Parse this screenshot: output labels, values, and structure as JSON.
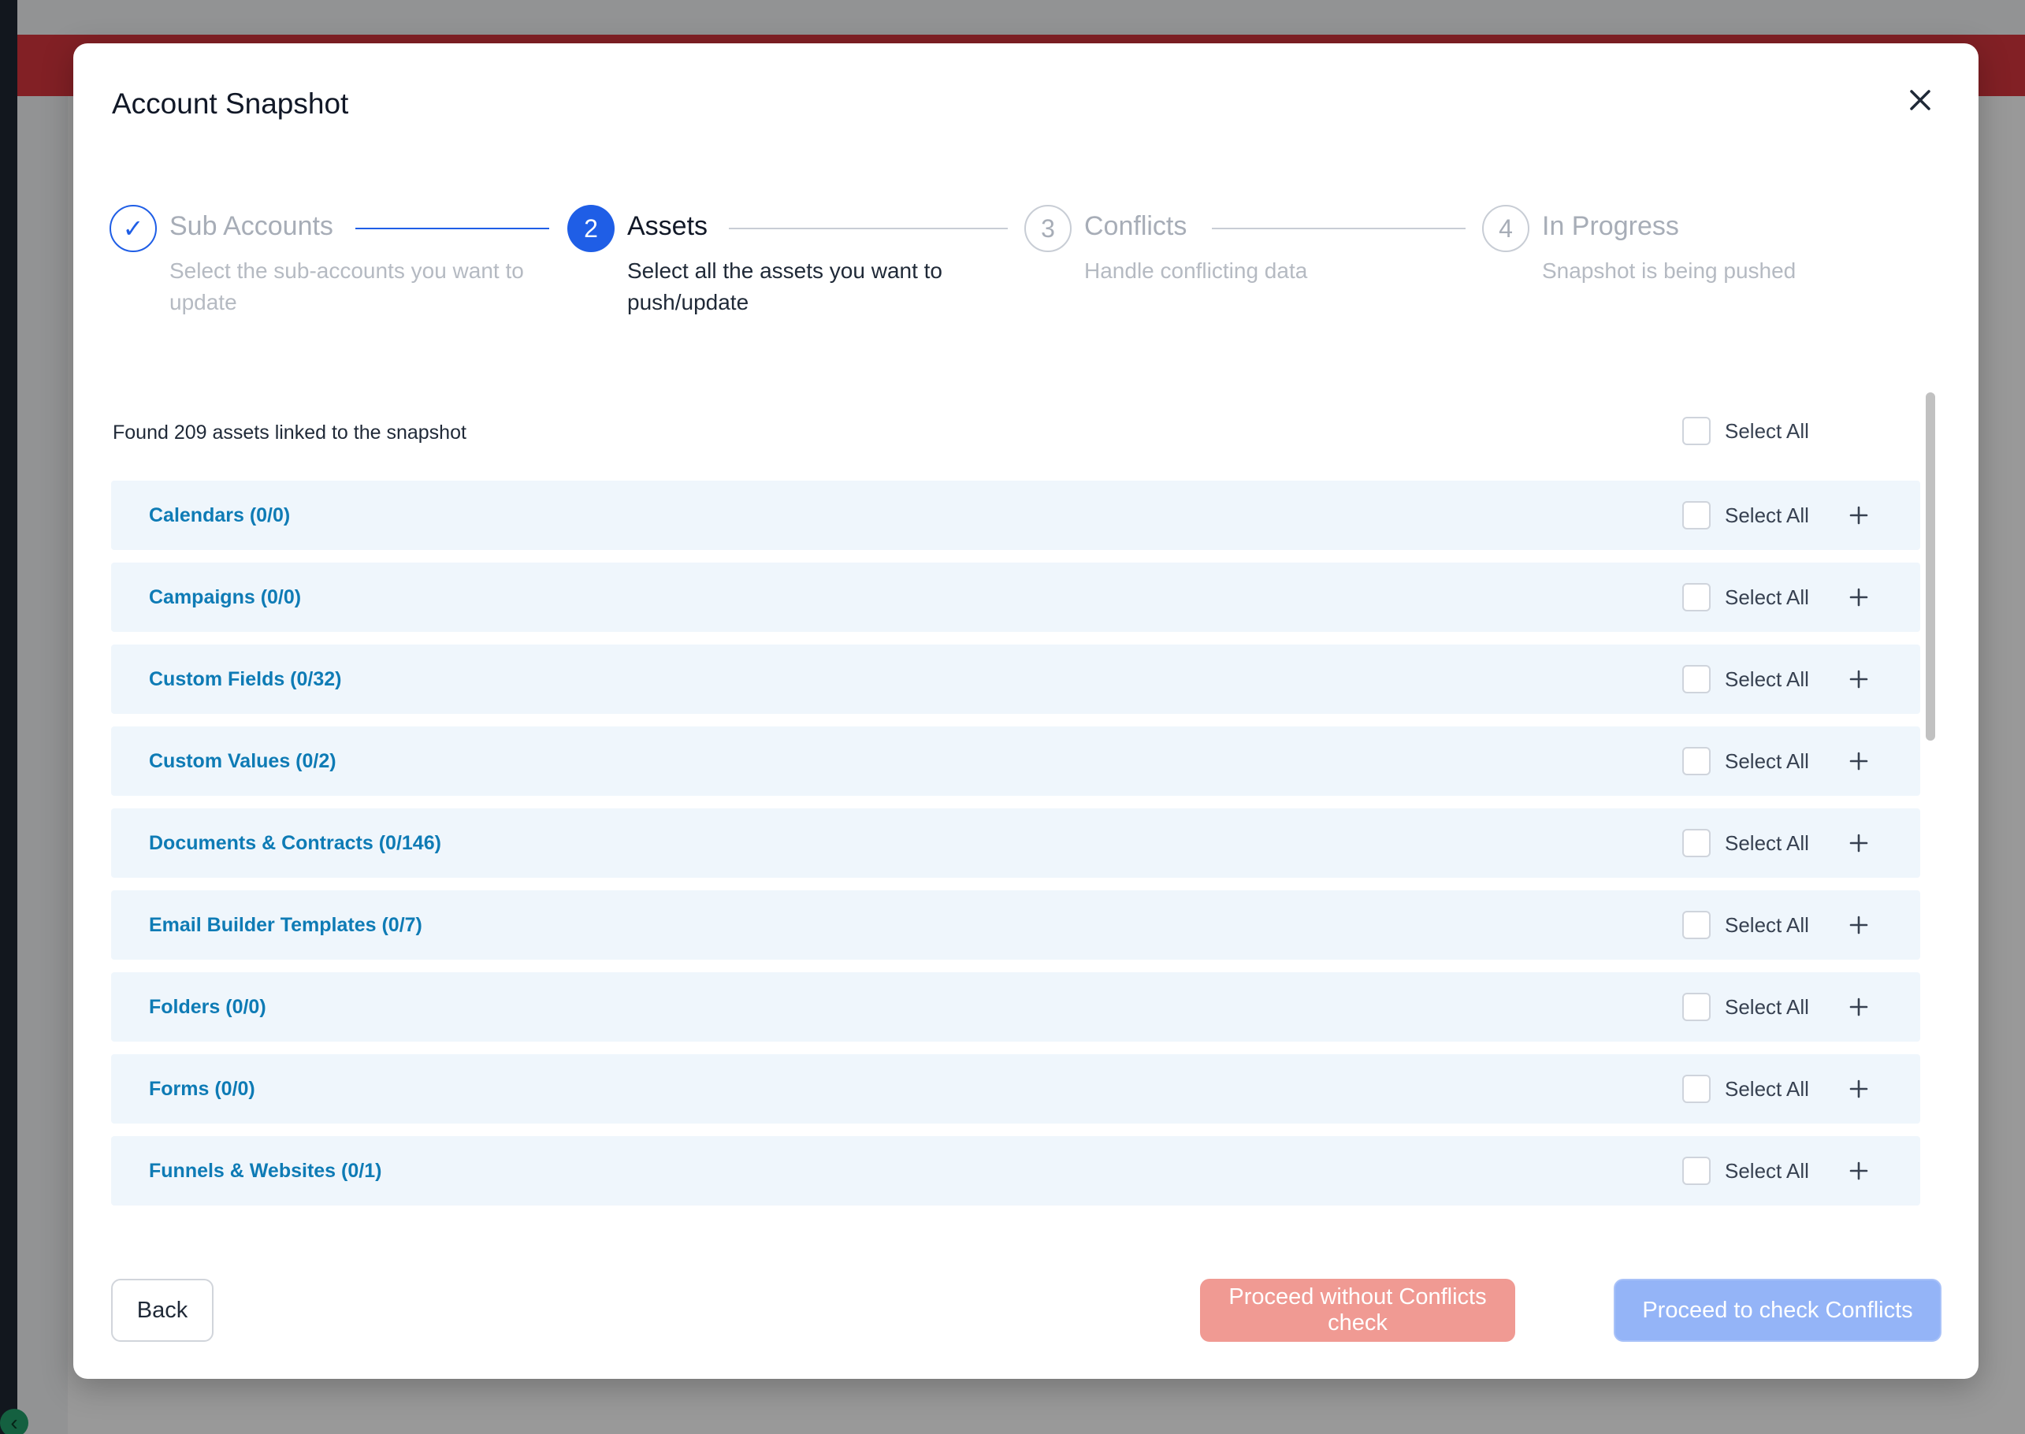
{
  "modal": {
    "title": "Account Snapshot"
  },
  "steps": [
    {
      "number": "✓",
      "title": "Sub Accounts",
      "desc": "Select the sub-accounts you want to update",
      "state": "done"
    },
    {
      "number": "2",
      "title": "Assets",
      "desc": "Select all the assets you want to push/update",
      "state": "active"
    },
    {
      "number": "3",
      "title": "Conflicts",
      "desc": "Handle conflicting data",
      "state": "pending"
    },
    {
      "number": "4",
      "title": "In Progress",
      "desc": "Snapshot is being pushed",
      "state": "pending"
    }
  ],
  "assets": {
    "found_text": "Found 209 assets linked to the snapshot",
    "select_all_label": "Select All",
    "items": [
      {
        "label": "Calendars (0/0)"
      },
      {
        "label": "Campaigns (0/0)"
      },
      {
        "label": "Custom Fields (0/32)"
      },
      {
        "label": "Custom Values (0/2)"
      },
      {
        "label": "Documents & Contracts (0/146)"
      },
      {
        "label": "Email Builder Templates (0/7)"
      },
      {
        "label": "Folders (0/0)"
      },
      {
        "label": "Forms (0/0)"
      },
      {
        "label": "Funnels & Websites (0/1)"
      }
    ]
  },
  "footer": {
    "back_label": "Back",
    "proceed_without_label": "Proceed without Conflicts check",
    "proceed_check_label": "Proceed to check Conflicts"
  },
  "colors": {
    "primary": "#1f5ee6",
    "asset_link": "#0e7bb5",
    "danger_light": "#f09a93",
    "primary_light": "#94b4f7",
    "topbar_red": "#d9363e"
  }
}
